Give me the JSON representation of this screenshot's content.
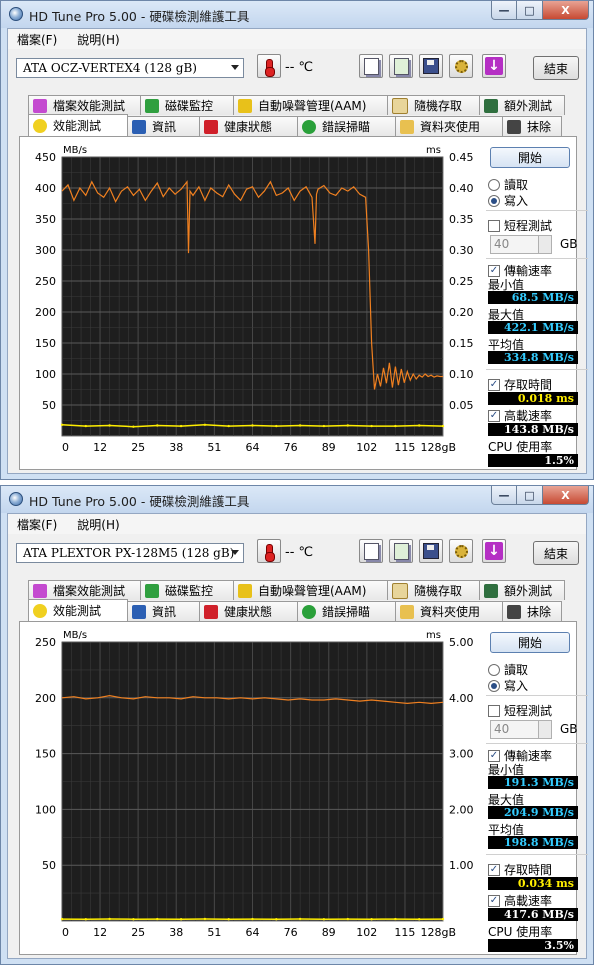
{
  "windows": [
    {
      "title": "HD Tune Pro 5.00 - 硬碟檢測維護工具",
      "window_controls": {
        "minimize": "—",
        "maximize": "□",
        "close": "X"
      },
      "menu": [
        {
          "label": "檔案(F)"
        },
        {
          "label": "說明(H)"
        }
      ],
      "drive": "ATA    OCZ-VERTEX4    (128 gB)",
      "temperature": "-- ℃",
      "exit_label": "結束",
      "tabs_back": [
        {
          "label": "檔案效能測試"
        },
        {
          "label": "磁碟監控"
        },
        {
          "label": "自動噪聲管理(AAM)"
        },
        {
          "label": "隨機存取"
        },
        {
          "label": "額外測試"
        }
      ],
      "tabs_front": [
        {
          "label": "效能測試"
        },
        {
          "label": "資訊"
        },
        {
          "label": "健康狀態"
        },
        {
          "label": "錯誤掃瞄"
        },
        {
          "label": "資料夾使用"
        },
        {
          "label": "抹除"
        }
      ],
      "panel": {
        "start_label": "開始",
        "read_label": "讀取",
        "write_label": "寫入",
        "selected_mode": "write",
        "short_test_label": "短程測試",
        "short_test_checked": false,
        "short_test_value": "40",
        "gb_label": "GB",
        "transfer_label": "傳輸速率",
        "min_label": "最小值",
        "min_value": "68.5 MB/s",
        "max_label": "最大值",
        "max_value": "422.1 MB/s",
        "avg_label": "平均值",
        "avg_value": "334.8 MB/s",
        "access_label": "存取時間",
        "access_value": "0.018 ms",
        "burst_label": "高載速率",
        "burst_value": "143.8 MB/s",
        "cpu_label": "CPU 使用率",
        "cpu_value": "1.5%",
        "value_color": "#33ccff",
        "access_color": "#ffee00"
      }
    },
    {
      "title": "HD Tune Pro 5.00 - 硬碟檢測維護工具",
      "window_controls": {
        "minimize": "—",
        "maximize": "□",
        "close": "X"
      },
      "menu": [
        {
          "label": "檔案(F)"
        },
        {
          "label": "說明(H)"
        }
      ],
      "drive": "ATA    PLEXTOR PX-128M5 (128 gB)",
      "temperature": "-- ℃",
      "exit_label": "結束",
      "tabs_back": [
        {
          "label": "檔案效能測試"
        },
        {
          "label": "磁碟監控"
        },
        {
          "label": "自動噪聲管理(AAM)"
        },
        {
          "label": "隨機存取"
        },
        {
          "label": "額外測試"
        }
      ],
      "tabs_front": [
        {
          "label": "效能測試"
        },
        {
          "label": "資訊"
        },
        {
          "label": "健康狀態"
        },
        {
          "label": "錯誤掃瞄"
        },
        {
          "label": "資料夾使用"
        },
        {
          "label": "抹除"
        }
      ],
      "panel": {
        "start_label": "開始",
        "read_label": "讀取",
        "write_label": "寫入",
        "selected_mode": "write",
        "short_test_label": "短程測試",
        "short_test_checked": false,
        "short_test_value": "40",
        "gb_label": "GB",
        "transfer_label": "傳輸速率",
        "min_label": "最小值",
        "min_value": "191.3 MB/s",
        "max_label": "最大值",
        "max_value": "204.9 MB/s",
        "avg_label": "平均值",
        "avg_value": "198.8 MB/s",
        "access_label": "存取時間",
        "access_value": "0.034 ms",
        "burst_label": "高載速率",
        "burst_value": "417.6 MB/s",
        "cpu_label": "CPU 使用率",
        "cpu_value": "3.5%",
        "value_color": "#33ccff",
        "access_color": "#ffee00"
      }
    }
  ],
  "chart_data": [
    {
      "type": "line",
      "y_unit_left": "MB/s",
      "y_unit_right": "ms",
      "ylim": [
        0,
        450
      ],
      "y2lim": [
        0,
        0.45
      ],
      "yticks": [
        "450",
        "400",
        "350",
        "300",
        "250",
        "200",
        "150",
        "100",
        "50"
      ],
      "y2ticks": [
        "0.45",
        "0.40",
        "0.35",
        "0.30",
        "0.25",
        "0.20",
        "0.15",
        "0.10",
        "0.05"
      ],
      "xticks": [
        "0",
        "12",
        "25",
        "38",
        "51",
        "64",
        "76",
        "89",
        "102",
        "115",
        "128gB"
      ],
      "xlim": [
        0,
        128
      ],
      "series": [
        {
          "role": "transfer_rate",
          "color": "#f08020",
          "x": [
            0,
            2,
            4,
            6,
            8,
            10,
            12,
            14,
            16,
            18,
            20,
            22,
            24,
            26,
            28,
            30,
            32,
            34,
            36,
            38,
            40,
            42,
            42.5,
            43,
            44,
            46,
            48,
            50,
            52,
            54,
            56,
            58,
            60,
            62,
            64,
            66,
            68,
            70,
            72,
            74,
            76,
            78,
            80,
            82,
            84,
            85,
            85.5,
            86,
            88,
            90,
            92,
            94,
            96,
            98,
            100,
            102,
            103,
            104,
            105,
            106,
            107,
            108,
            109,
            110,
            111,
            112,
            113,
            114,
            115,
            116,
            117,
            118,
            119,
            120,
            121,
            122,
            123,
            124,
            125,
            126,
            127,
            128
          ],
          "values": [
            395,
            405,
            380,
            400,
            388,
            410,
            392,
            385,
            400,
            378,
            395,
            402,
            388,
            398,
            380,
            395,
            408,
            386,
            400,
            390,
            398,
            410,
            295,
            395,
            388,
            402,
            380,
            400,
            392,
            386,
            405,
            390,
            380,
            398,
            402,
            385,
            395,
            410,
            388,
            392,
            400,
            380,
            395,
            402,
            385,
            310,
            390,
            398,
            404,
            392,
            388,
            400,
            395,
            402,
            390,
            385,
            300,
            150,
            75,
            100,
            80,
            110,
            85,
            118,
            78,
            112,
            82,
            108,
            86,
            104,
            90,
            100,
            92,
            98,
            95,
            100,
            96,
            98,
            95,
            97,
            96,
            96
          ]
        },
        {
          "role": "access_time",
          "color": "#ffee00",
          "x": [
            0,
            8,
            16,
            24,
            32,
            40,
            48,
            56,
            64,
            72,
            80,
            88,
            96,
            104,
            112,
            120,
            128
          ],
          "values": [
            0.018,
            0.016,
            0.017,
            0.015,
            0.017,
            0.016,
            0.018,
            0.016,
            0.017,
            0.016,
            0.017,
            0.016,
            0.017,
            0.016,
            0.016,
            0.017,
            0.016
          ]
        }
      ]
    },
    {
      "type": "line",
      "y_unit_left": "MB/s",
      "y_unit_right": "ms",
      "ylim": [
        0,
        250
      ],
      "y2lim": [
        0,
        5
      ],
      "yticks": [
        "250",
        "200",
        "150",
        "100",
        "50"
      ],
      "y2ticks": [
        "5.00",
        "4.00",
        "3.00",
        "2.00",
        "1.00"
      ],
      "xticks": [
        "0",
        "12",
        "25",
        "38",
        "51",
        "64",
        "76",
        "89",
        "102",
        "115",
        "128gB"
      ],
      "xlim": [
        0,
        128
      ],
      "series": [
        {
          "role": "transfer_rate",
          "color": "#f08020",
          "x": [
            0,
            4,
            8,
            12,
            16,
            20,
            24,
            28,
            32,
            36,
            40,
            44,
            48,
            52,
            56,
            60,
            64,
            68,
            72,
            76,
            80,
            84,
            88,
            92,
            96,
            100,
            104,
            108,
            112,
            116,
            120,
            124,
            128
          ],
          "values": [
            200,
            201,
            199,
            200,
            202,
            200,
            199,
            201,
            200,
            200,
            199,
            201,
            200,
            200,
            199,
            200,
            199,
            200,
            199,
            198,
            199,
            198,
            198,
            199,
            198,
            197,
            198,
            197,
            196,
            195,
            196,
            195,
            196
          ]
        },
        {
          "role": "access_time",
          "color": "#ffee00",
          "x": [
            0,
            8,
            16,
            24,
            32,
            40,
            48,
            56,
            64,
            72,
            80,
            88,
            96,
            104,
            112,
            120,
            128
          ],
          "values": [
            0.034,
            0.032,
            0.035,
            0.033,
            0.034,
            0.032,
            0.035,
            0.033,
            0.034,
            0.033,
            0.035,
            0.032,
            0.034,
            0.033,
            0.034,
            0.032,
            0.034
          ]
        }
      ]
    }
  ]
}
